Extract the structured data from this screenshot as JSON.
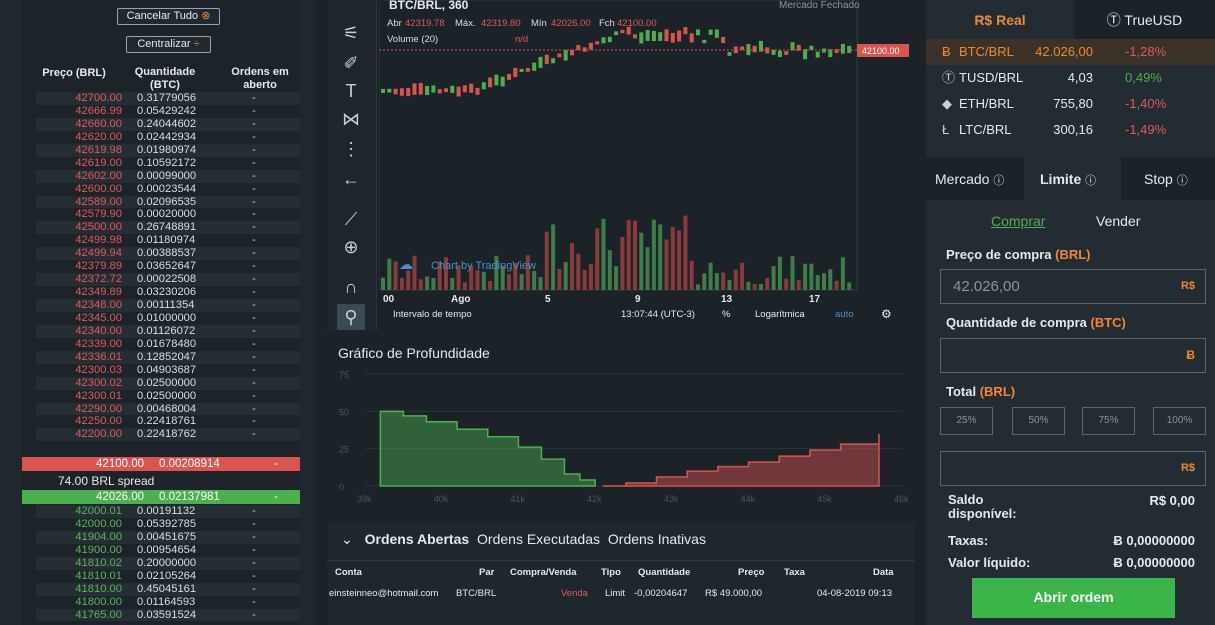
{
  "orderbook": {
    "cancel_all": "Cancelar Tudo",
    "center": "Centralizar",
    "headers": {
      "price": "Preço (BRL)",
      "qty": "Quantidade (BTC)",
      "open": "Ordens em aberto"
    },
    "asks": [
      [
        "42700.00",
        "0.31779056",
        "-"
      ],
      [
        "42666.99",
        "0.05429242",
        "-"
      ],
      [
        "42660.00",
        "0.24044602",
        "-"
      ],
      [
        "42620.00",
        "0.02442934",
        "-"
      ],
      [
        "42619.98",
        "0.01980974",
        "-"
      ],
      [
        "42619.00",
        "0.10592172",
        "-"
      ],
      [
        "42602.00",
        "0.00099000",
        "-"
      ],
      [
        "42600.00",
        "0.00023544",
        "-"
      ],
      [
        "42589.00",
        "0.02096535",
        "-"
      ],
      [
        "42579.90",
        "0.00020000",
        "-"
      ],
      [
        "42500.00",
        "0.26748891",
        "-"
      ],
      [
        "42499.98",
        "0.01180974",
        "-"
      ],
      [
        "42499.94",
        "0.00388537",
        "-"
      ],
      [
        "42379.89",
        "0.03652647",
        "-"
      ],
      [
        "42372.72",
        "0.00022508",
        "-"
      ],
      [
        "42349.89",
        "0.03230206",
        "-"
      ],
      [
        "42348.00",
        "0.00111354",
        "-"
      ],
      [
        "42345.00",
        "0.01000000",
        "-"
      ],
      [
        "42340.00",
        "0.01126072",
        "-"
      ],
      [
        "42339.00",
        "0.01678480",
        "-"
      ],
      [
        "42336.01",
        "0.12852047",
        "-"
      ],
      [
        "42300.03",
        "0.04903687",
        "-"
      ],
      [
        "42300.02",
        "0.02500000",
        "-"
      ],
      [
        "42300.01",
        "0.02500000",
        "-"
      ],
      [
        "42290.00",
        "0.00468004",
        "-"
      ],
      [
        "42250.00",
        "0.22418761",
        "-"
      ],
      [
        "42200.00",
        "0.22418762",
        "-"
      ]
    ],
    "best_ask": [
      "42100.00",
      "0.00208914",
      "-"
    ],
    "spread": "74.00 BRL spread",
    "best_bid": [
      "42026.00",
      "0.02137981",
      "-"
    ],
    "bids": [
      [
        "42000.01",
        "0.00191132",
        "-"
      ],
      [
        "42000.00",
        "0.05392785",
        "-"
      ],
      [
        "41904.00",
        "0.00451675",
        "-"
      ],
      [
        "41900.00",
        "0.00954654",
        "-"
      ],
      [
        "41810.02",
        "0.20000000",
        "-"
      ],
      [
        "41810.01",
        "0.02105264",
        "-"
      ],
      [
        "41810.00",
        "0.45045161",
        "-"
      ],
      [
        "41800.00",
        "0.01164593",
        "-"
      ],
      [
        "41765.00",
        "0.03591524",
        "-"
      ]
    ]
  },
  "chart": {
    "symbol": "BTC/BRL, 360",
    "ohlc": {
      "abr_label": "Abr",
      "abr": "42319.78",
      "max_label": "Máx.",
      "max": "42319.80",
      "min_label": "Mín",
      "min": "42026.00",
      "fch_label": "Fch",
      "fch": "42100.00"
    },
    "market_closed": "Mercado Fechado",
    "volume_label": "Volume (20)",
    "volume_value": "n/d",
    "price_marker": "42100.00",
    "watermark": "Chart by TradingView",
    "x_ticks": [
      "00",
      "Ago",
      "5",
      "9",
      "13",
      "17"
    ],
    "interval_label": "Intervalo de tempo",
    "time": "13:07:44 (UTC-3)",
    "pct": "%",
    "log": "Logarítmica",
    "auto": "auto"
  },
  "chart_data": {
    "type": "area",
    "title": "Gráfico de Profundidade",
    "x_ticks": [
      "39k",
      "40k",
      "41k",
      "42k",
      "43k",
      "44k",
      "45k",
      "46k"
    ],
    "y_ticks": [
      "75",
      "50",
      "25",
      "0"
    ],
    "series": [
      {
        "color": "#4caf50",
        "x": [
          39200,
          39500,
          39800,
          40200,
          40600,
          41000,
          41300,
          41600,
          41800,
          42000
        ],
        "y": [
          50,
          47,
          43,
          38,
          33,
          26,
          18,
          8,
          4,
          0
        ]
      },
      {
        "color": "#d9534f",
        "x": [
          42100,
          42400,
          42800,
          43200,
          43600,
          44000,
          44400,
          44800,
          45200,
          45700
        ],
        "y": [
          0,
          2,
          6,
          10,
          13,
          16,
          20,
          24,
          28,
          35
        ]
      }
    ]
  },
  "orders_panel": {
    "tabs": [
      "Ordens Abertas",
      "Ordens Executadas",
      "Ordens Inativas"
    ],
    "headers": [
      "Conta",
      "Par",
      "Compra/Venda",
      "Tipo",
      "Quantidade",
      "Preço",
      "Taxa",
      "Data"
    ],
    "row": [
      "einsteinneo@hotmail.com",
      "BTC/BRL",
      "Venda",
      "Limit",
      "-0,00204647",
      "R$ 49.000,00",
      "",
      "04-08-2019 09:13"
    ]
  },
  "markets": {
    "tabs": [
      "R$ Real",
      "TrueUSD"
    ],
    "rows": [
      [
        "BTC/BRL",
        "42.026,00",
        "-1,28%"
      ],
      [
        "TUSD/BRL",
        "4,03",
        "0,49%"
      ],
      [
        "ETH/BRL",
        "755,80",
        "-1,40%"
      ],
      [
        "LTC/BRL",
        "300,16",
        "-1,49%"
      ]
    ]
  },
  "trade": {
    "order_tabs": [
      "Mercado",
      "Limite",
      "Stop"
    ],
    "side_tabs": [
      "Comprar",
      "Vender"
    ],
    "price_label": "Preço de compra",
    "price_unit": "(BRL)",
    "price_value": "42.026,00",
    "price_suffix": "R$",
    "qty_label": "Quantidade de compra",
    "qty_unit": "(BTC)",
    "qty_suffix": "Ƀ",
    "total_label": "Total",
    "total_unit": "(BRL)",
    "total_suffix": "R$",
    "pcts": [
      "25%",
      "50%",
      "75%",
      "100%"
    ],
    "balance_label": "Saldo disponível:",
    "balance_value": "R$ 0,00",
    "fees_label": "Taxas:",
    "fees_value": "Ƀ 0,00000000",
    "net_label": "Valor líquido:",
    "net_value": "Ƀ 0,00000000",
    "submit": "Abrir ordem"
  },
  "colors": {
    "ask": "#e05a5a",
    "bid": "#5ab55a",
    "accent": "#f0882d",
    "submit": "#3bb54a"
  }
}
